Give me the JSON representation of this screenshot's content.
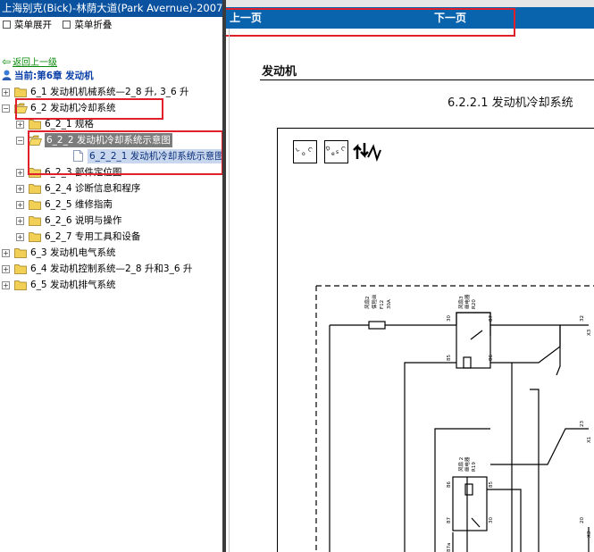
{
  "window_title": "上海别克(Bick)-林荫大道(Park Avernue)-2007",
  "menu": {
    "expand": "菜单展开",
    "collapse": "菜单折叠"
  },
  "back_link": "返回上一级",
  "current": "当前:第6章 发动机",
  "tree": [
    {
      "label": "6_1 发动机机械系统—2_8 升, 3_6 升",
      "level": 0,
      "sign": "+",
      "icon": "folder"
    },
    {
      "label": "6_2 发动机冷却系统",
      "level": 0,
      "sign": "-",
      "icon": "folder-open"
    },
    {
      "label": "6_2_1 规格",
      "level": 1,
      "sign": "+",
      "icon": "folder"
    },
    {
      "label": "6_2_2 发动机冷却系统示意图",
      "level": 1,
      "sign": "-",
      "icon": "folder-open",
      "selected": true
    },
    {
      "label": "6_2_2_1 发动机冷却系统示意图",
      "level": 2,
      "sign": "",
      "icon": "doc",
      "selected2": true
    },
    {
      "label": "6_2_3 部件定位图",
      "level": 1,
      "sign": "+",
      "icon": "folder"
    },
    {
      "label": "6_2_4 诊断信息和程序",
      "level": 1,
      "sign": "+",
      "icon": "folder"
    },
    {
      "label": "6_2_5 维修指南",
      "level": 1,
      "sign": "+",
      "icon": "folder"
    },
    {
      "label": "6_2_6 说明与操作",
      "level": 1,
      "sign": "+",
      "icon": "folder"
    },
    {
      "label": "6_2_7 专用工具和设备",
      "level": 1,
      "sign": "+",
      "icon": "folder"
    },
    {
      "label": "6_3 发动机电气系统",
      "level": 0,
      "sign": "+",
      "icon": "folder"
    },
    {
      "label": "6_4 发动机控制系统—2_8 升和3_6 升",
      "level": 0,
      "sign": "+",
      "icon": "folder"
    },
    {
      "label": "6_5 发动机排气系统",
      "level": 0,
      "sign": "+",
      "icon": "folder"
    }
  ],
  "nav": {
    "prev": "上一页",
    "next": "下一页"
  },
  "doc": {
    "section": "发动机",
    "figure_title": "6.2.2.1 发动机冷却系统",
    "icon_names": [
      "loc-icon",
      "desc-icon",
      "wiring-icon"
    ],
    "diagram_labels": {
      "fuse": [
        "风扇2",
        "保险丝",
        "F12",
        "30A"
      ],
      "relay3": [
        "风扇3",
        "继电器",
        "R20"
      ],
      "relay2": [
        "风扇 2",
        "继电器",
        "R19"
      ],
      "pins": [
        "30",
        "87",
        "85",
        "86",
        "86",
        "85",
        "87",
        "30",
        "87a"
      ],
      "connectors": [
        "32",
        "X3",
        "23",
        "X1",
        "20",
        "X3"
      ]
    }
  },
  "colors": {
    "title_bar": "#0a52a0",
    "nav_bar": "#0a63ad",
    "highlight": "#e0202a",
    "selection": "#7c7c7c"
  }
}
